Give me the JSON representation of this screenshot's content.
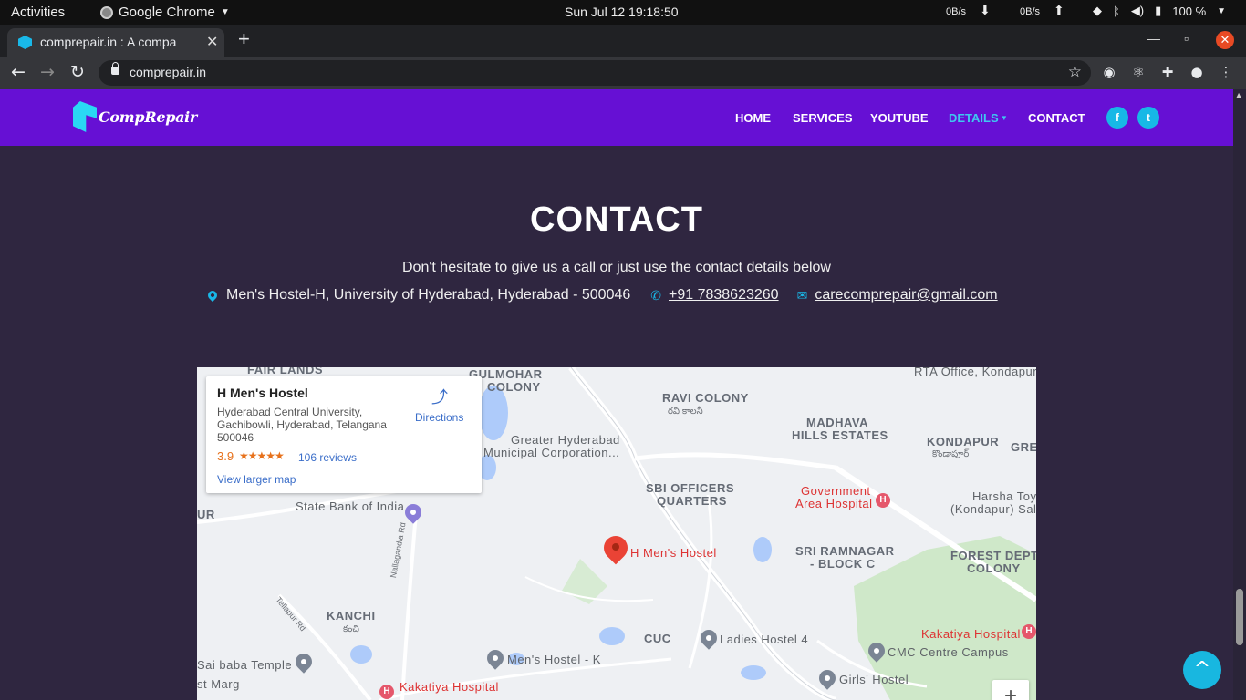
{
  "os": {
    "activities": "Activities",
    "app_name": "Google Chrome",
    "clock": "Sun Jul 12  19:18:50",
    "net_down": "0B/s",
    "net_up": "0B/s",
    "battery": "100 %"
  },
  "browser": {
    "tab_title": "comprepair.in : A company",
    "url": "comprepair.in"
  },
  "site": {
    "logo_text": "CompRepair",
    "nav": [
      {
        "label": "HOME"
      },
      {
        "label": "SERVICES"
      },
      {
        "label": "YOUTUBE"
      },
      {
        "label": "DETAILS"
      },
      {
        "label": "CONTACT"
      }
    ],
    "active_nav": "DETAILS",
    "colors": {
      "navbar": "#6610d4",
      "accent": "#19b8e8",
      "background": "#2f2640"
    }
  },
  "contact": {
    "title": "CONTACT",
    "subtitle": "Don't hesitate to give us a call or just use the contact details below",
    "address": "Men's Hostel-H, University of Hyderabad, Hyderabad - 500046",
    "phone": "+91 7838623260",
    "email": "carecomprepair@gmail.com"
  },
  "map": {
    "place_name": "H Men's Hostel",
    "address": "Hyderabad Central University, Gachibowli, Hyderabad, Telangana 500046",
    "rating": "3.9",
    "stars": "★★★★★",
    "reviews": "106 reviews",
    "larger_map": "View larger map",
    "directions": "Directions",
    "marker_label": "H Men's Hostel",
    "labels": {
      "fair_lands": "FAIR LANDS",
      "gulmohar": "GULMOHAR",
      "colony_top": "COLONY",
      "ravi": "RAVI COLONY",
      "ravi_tel": "రవి కాలనీ",
      "madhava1": "MADHAVA",
      "madhava2": "HILLS ESTATES",
      "kondapur": "KONDAPUR",
      "kondapur_tel": "కొండాపూర్",
      "rta": "RTA Office, Kondapur",
      "greater1": "Greater Hyderabad",
      "greater2": "Municipal Corporation...",
      "sbi1": "SBI OFFICERS",
      "sbi2": "QUARTERS",
      "gov1": "Government",
      "gov2": "Area Hospital",
      "harsha1": "Harsha Toy",
      "harsha2": "(Kondapur) Sal",
      "sbi_bank": "State Bank of India",
      "sri1": "SRI RAMNAGAR",
      "sri2": "- BLOCK C",
      "forest1": "FOREST DEPT",
      "forest2": "COLONY",
      "kanchi": "KANCHI",
      "kanchi_tel": "కంచి",
      "cuc": "CUC",
      "ladies": "Ladies Hostel 4",
      "kakatiya_right": "Kakatiya Hospital",
      "cmc": "CMC Centre Campus",
      "sai": "Sai baba Temple",
      "mens_k": "Men's Hostel - K",
      "girls": "Girls' Hostel",
      "kakatiya_bottom": "Kakatiya Hospital",
      "st_marg": "st Marg",
      "nallagandla": "Nallagandla Rd",
      "tellapur": "Tellapur Rd",
      "ur": "UR",
      "gre": "GRE"
    },
    "zoom_in": "+"
  },
  "back_to_top": "^"
}
